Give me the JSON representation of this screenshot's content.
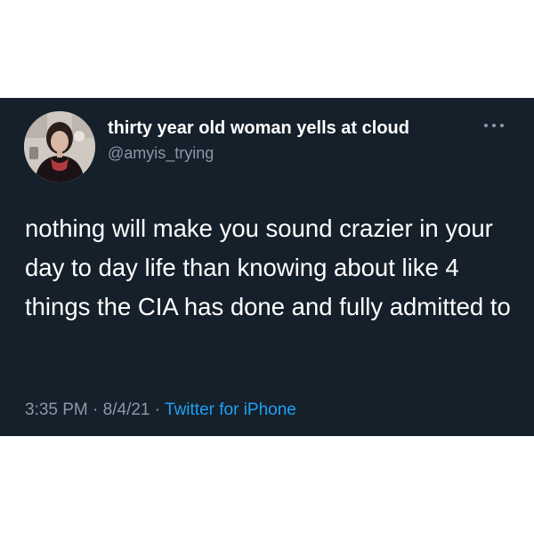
{
  "tweet": {
    "author": {
      "display_name": "thirty year old woman yells at cloud",
      "handle": "@amyis_trying"
    },
    "text": "nothing will make you sound crazier in your day to day life than knowing about like 4 things the CIA has done and fully admitted to",
    "time": "3:35 PM",
    "separator": "·",
    "date": "8/4/21",
    "source": "Twitter for iPhone"
  },
  "icons": {
    "more": "more-horizontal-icon"
  },
  "colors": {
    "card_background": "#15202b",
    "primary_text": "#ffffff",
    "secondary_text": "#8899a6",
    "link": "#1da1f2"
  }
}
